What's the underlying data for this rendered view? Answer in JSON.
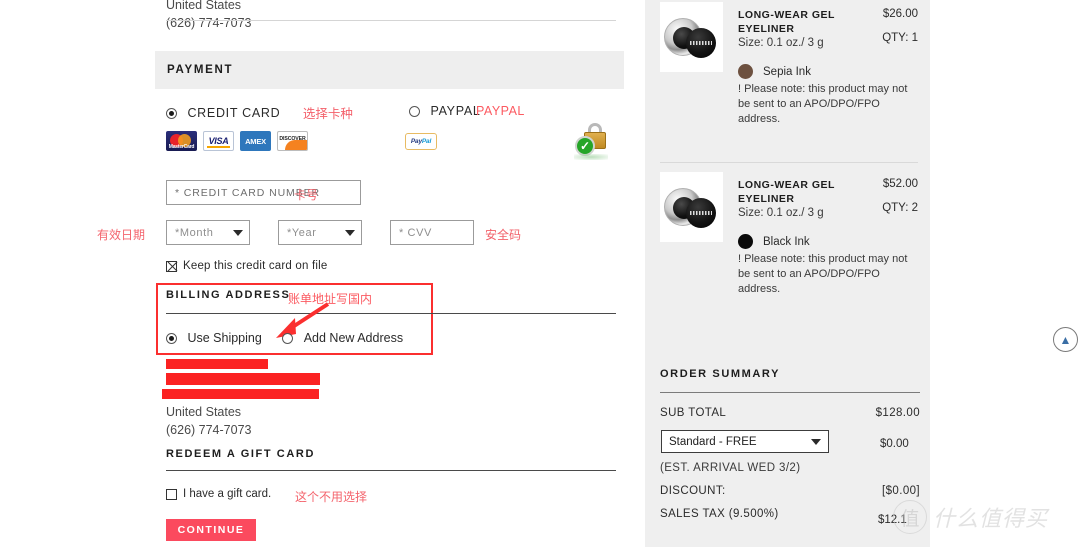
{
  "checkout": {
    "top_address": {
      "country": "United States",
      "phone": "(626) 774-7073"
    },
    "payment_section_title": "PAYMENT",
    "methods": {
      "credit_card_label": "CREDIT CARD",
      "credit_card_annotation": "选择卡种",
      "paypal_label": "PAYPAL",
      "paypal_annotation": "PAYPAL",
      "card_logos": [
        "MasterCard",
        "VISA",
        "AMEX",
        "DISCOVER"
      ],
      "paypal_logo_text": "PayPal",
      "security_badge": "secure-lock-badge"
    },
    "card_form": {
      "number_placeholder": "* CREDIT CARD NUMBER",
      "number_annotation": "卡号",
      "expiry_annotation": "有效日期",
      "month_value": "*Month",
      "year_value": "*Year",
      "cvv_placeholder": "* CVV",
      "cvv_annotation": "安全码",
      "keep_card_label": "Keep this credit card on file",
      "keep_card_checked": true
    },
    "billing": {
      "title": "BILLING ADDRESS",
      "annotation": "账单地址写国内",
      "use_shipping_label": "Use Shipping",
      "add_new_label": "Add New Address",
      "selected": "Use Shipping",
      "redacted_lines": 3,
      "country": "United States",
      "phone": "(626) 774-7073"
    },
    "gift_card": {
      "title": "REDEEM A GIFT CARD",
      "checkbox_label": "I have a gift card.",
      "checked": false,
      "annotation": "这个不用选择"
    },
    "continue_label": "CONTINUE"
  },
  "sidebar": {
    "items": [
      {
        "name": "LONG-WEAR GEL EYELINER",
        "size": "Size: 0.1 oz./ 3 g",
        "price": "$26.00",
        "qty": "QTY: 1",
        "shade": "Sepia Ink",
        "shade_color": "#6d5140",
        "note": "! Please note: this product may not be sent to an APO/DPO/FPO address."
      },
      {
        "name": "LONG-WEAR GEL EYELINER",
        "size": "Size: 0.1 oz./ 3 g",
        "price": "$52.00",
        "qty": "QTY: 2",
        "shade": "Black Ink",
        "shade_color": "#0a0a0a",
        "note": "! Please note: this product may not be sent to an APO/DPO/FPO address."
      }
    ],
    "summary": {
      "title": "ORDER SUMMARY",
      "sub_total_label": "SUB TOTAL",
      "sub_total_value": "$128.00",
      "shipping_option": "Standard - FREE",
      "shipping_value": "$0.00",
      "eta": "(EST. ARRIVAL WED 3/2)",
      "discount_label": "DISCOUNT:",
      "discount_value": "[$0.00]",
      "tax_label": "SALES TAX (9.500%)",
      "tax_value": "$12.1"
    }
  },
  "overlay": {
    "scroll_top_icon": "chevron-up-icon",
    "watermark_logo": "值",
    "watermark_text": "什么值得买"
  }
}
